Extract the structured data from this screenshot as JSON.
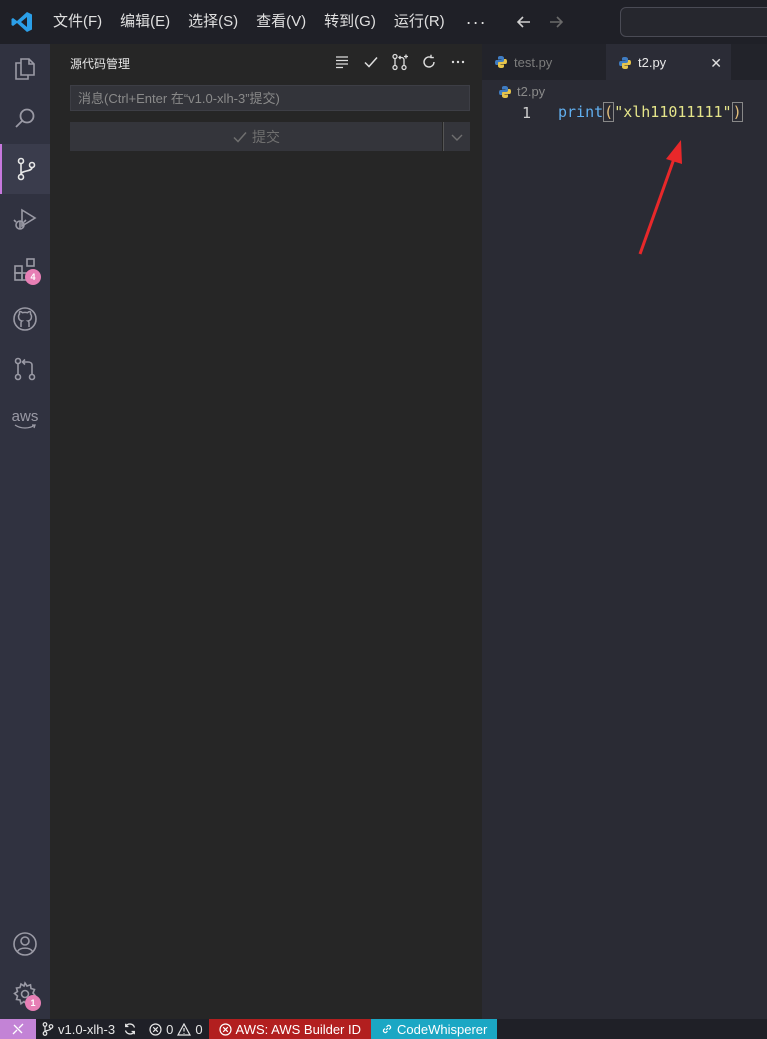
{
  "titlebar": {
    "menu": [
      "文件(F)",
      "编辑(E)",
      "选择(S)",
      "查看(V)",
      "转到(G)",
      "运行(R)"
    ],
    "more": "···"
  },
  "activitybar": {
    "extensions_badge": "4",
    "settings_badge": "1",
    "aws_label": "aws"
  },
  "sidebar": {
    "title": "源代码管理",
    "message_placeholder": "消息(Ctrl+Enter 在“v1.0-xlh-3”提交)",
    "commit_label": "提交"
  },
  "editor": {
    "tabs": [
      {
        "label": "test.py"
      },
      {
        "label": "t2.py",
        "close": "✕"
      }
    ],
    "breadcrumb": "t2.py",
    "line_number": "1",
    "code": {
      "func": "print",
      "open_paren": "(",
      "string": "\"xlh11011111\"",
      "close_paren": ")"
    }
  },
  "statusbar": {
    "branch": "v1.0-xlh-3",
    "errors": "0",
    "warnings": "0",
    "aws": "AWS: AWS Builder ID",
    "codewhisperer": "CodeWhisperer"
  },
  "colors": {
    "accent": "#c678dd",
    "annotation_arrow": "#e8282a",
    "aws_status": "#b21f1f",
    "codewhisperer_status": "#1ba7c4"
  }
}
